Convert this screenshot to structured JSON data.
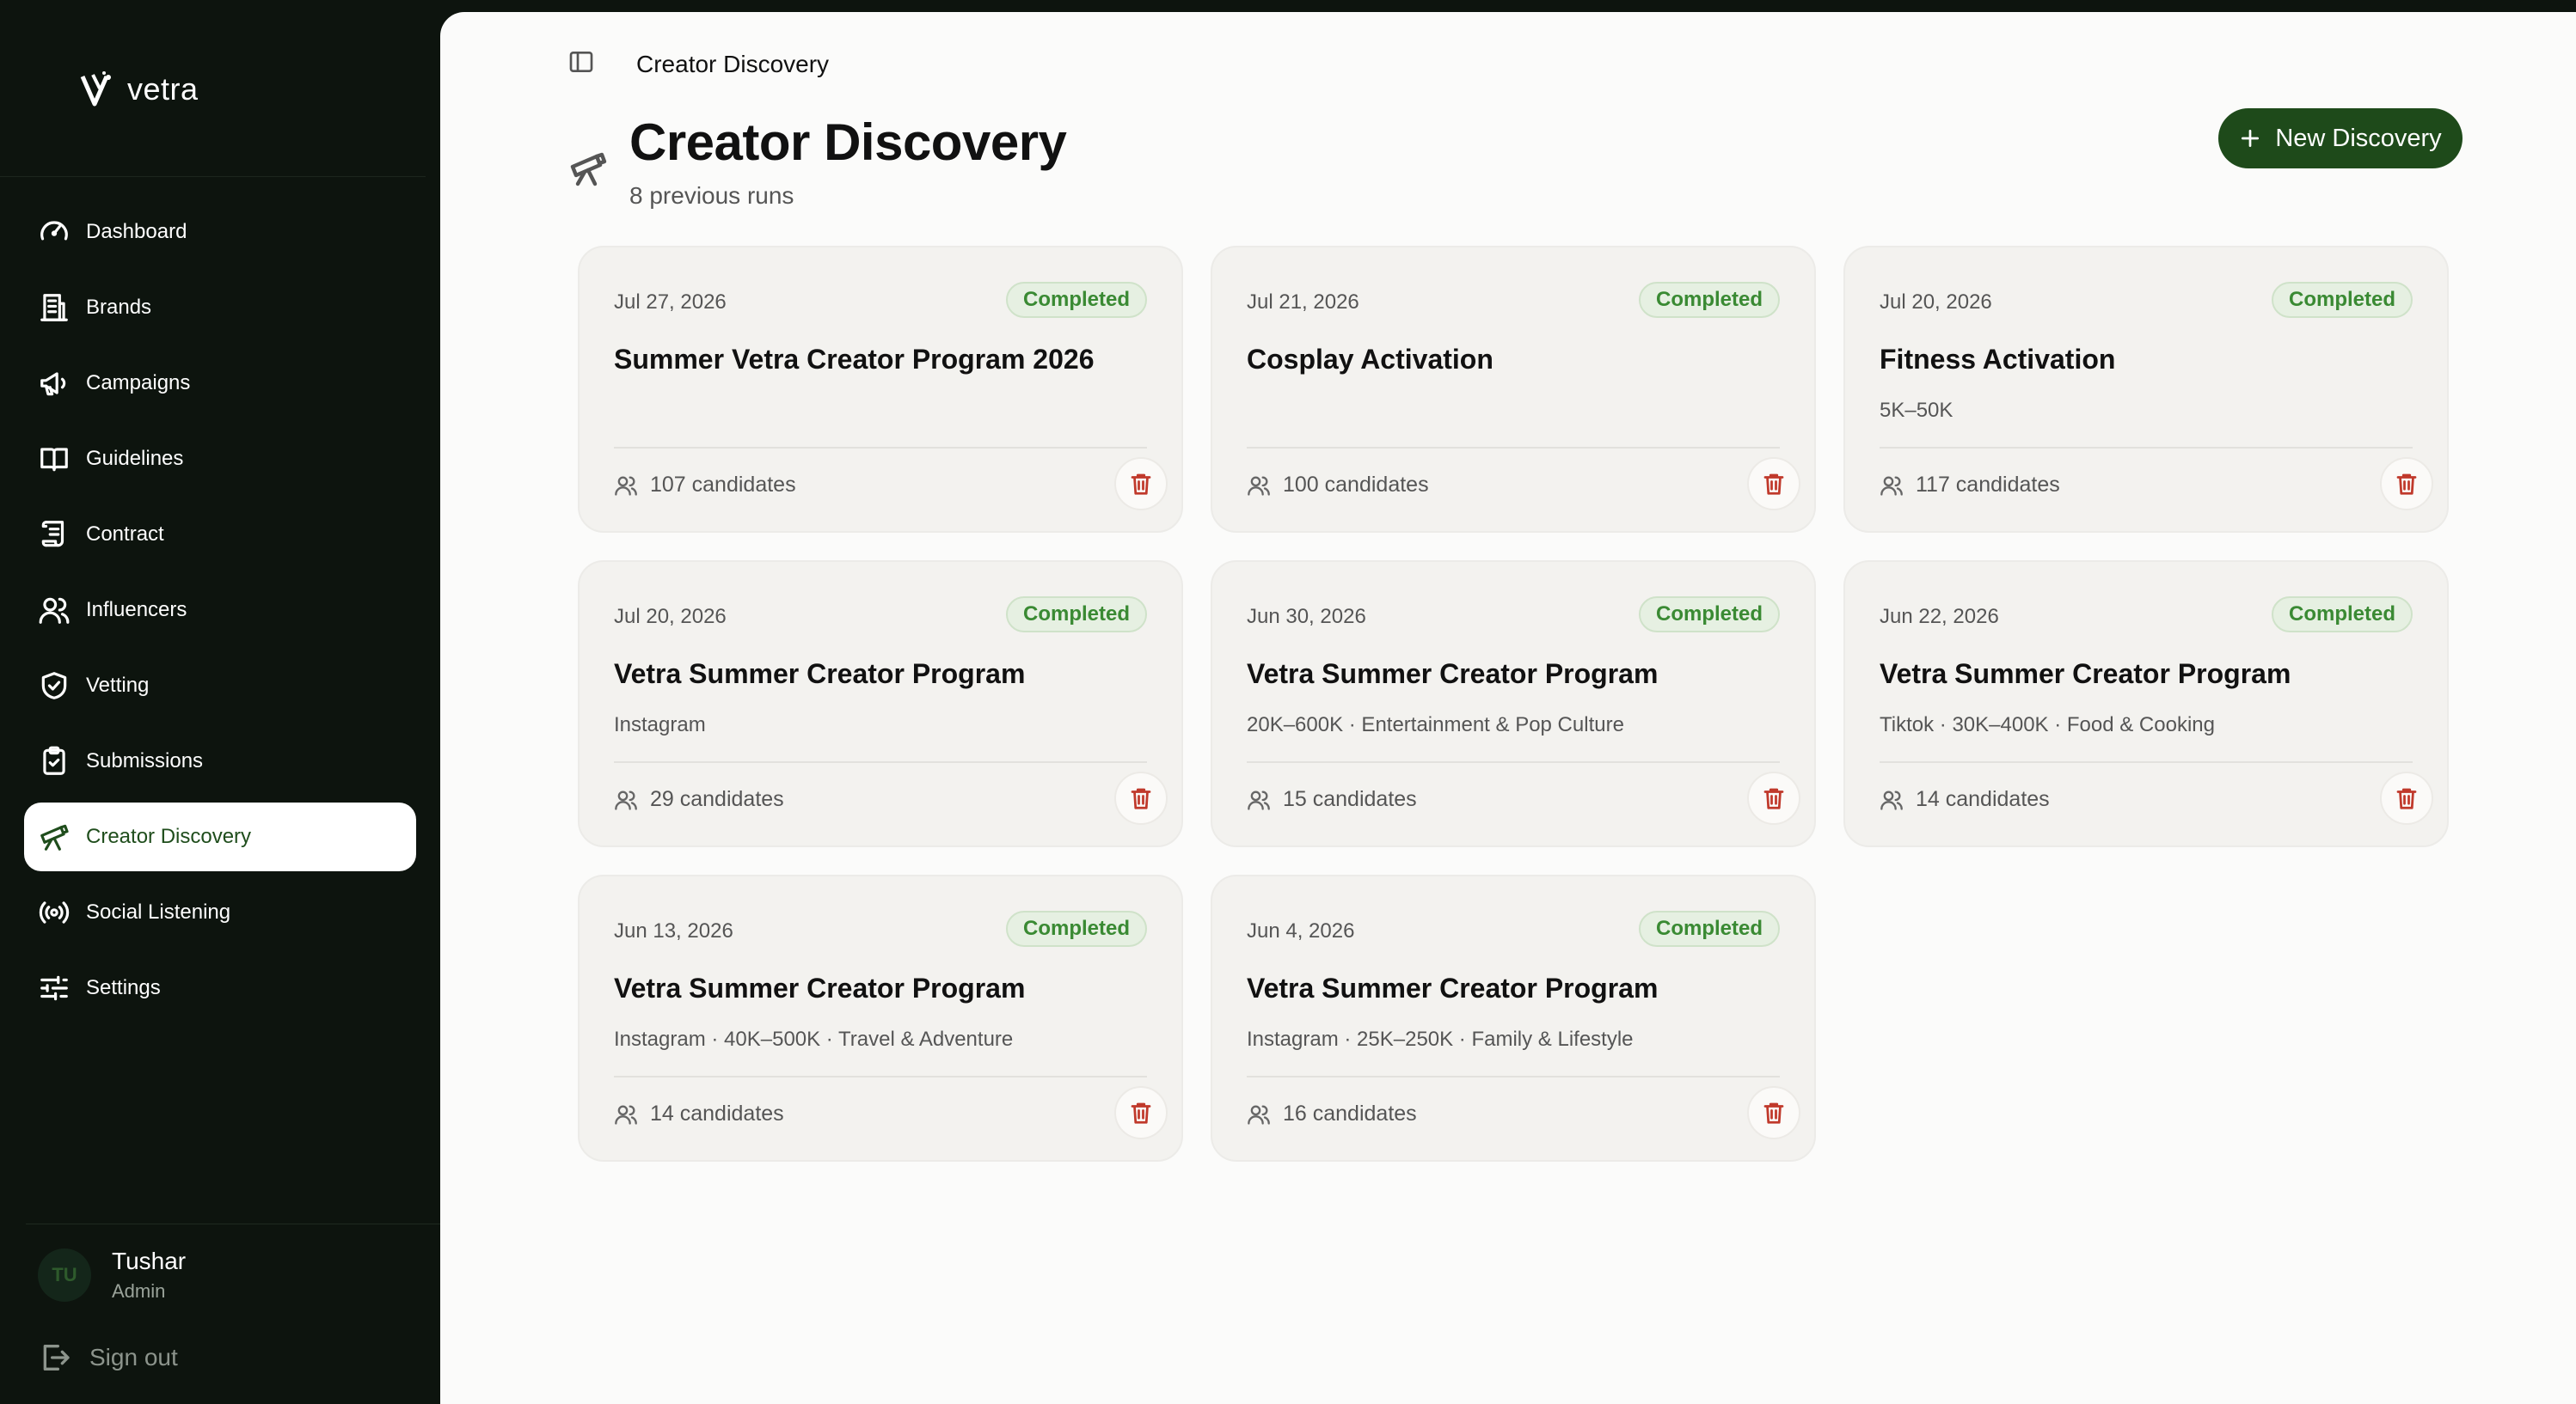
{
  "app": {
    "name": "vetra"
  },
  "sidebar": {
    "items": [
      {
        "label": "Dashboard",
        "icon": "gauge-icon"
      },
      {
        "label": "Brands",
        "icon": "building-icon"
      },
      {
        "label": "Campaigns",
        "icon": "megaphone-icon"
      },
      {
        "label": "Guidelines",
        "icon": "book-icon"
      },
      {
        "label": "Contract",
        "icon": "scroll-icon"
      },
      {
        "label": "Influencers",
        "icon": "users-icon"
      },
      {
        "label": "Vetting",
        "icon": "shield-check-icon"
      },
      {
        "label": "Submissions",
        "icon": "clipboard-check-icon"
      },
      {
        "label": "Creator Discovery",
        "icon": "telescope-icon",
        "active": true
      },
      {
        "label": "Social Listening",
        "icon": "broadcast-icon"
      },
      {
        "label": "Settings",
        "icon": "sliders-icon"
      }
    ],
    "user": {
      "initials": "TU",
      "name": "Tushar",
      "role": "Admin"
    },
    "sign_out": "Sign out"
  },
  "topbar": {
    "breadcrumb": "Creator Discovery"
  },
  "header": {
    "title": "Creator Discovery",
    "subtitle": "8 previous runs",
    "new_button": "New Discovery"
  },
  "cards": [
    {
      "date": "Jul 27, 2026",
      "status": "Completed",
      "title": "Summer Vetra Creator Program 2026",
      "meta": "",
      "candidates": "107 candidates"
    },
    {
      "date": "Jul 21, 2026",
      "status": "Completed",
      "title": "Cosplay Activation",
      "meta": "",
      "candidates": "100 candidates"
    },
    {
      "date": "Jul 20, 2026",
      "status": "Completed",
      "title": "Fitness Activation",
      "meta": "5K–50K",
      "candidates": "117 candidates"
    },
    {
      "date": "Jul 20, 2026",
      "status": "Completed",
      "title": "Vetra Summer Creator Program",
      "meta": "Instagram",
      "candidates": "29 candidates"
    },
    {
      "date": "Jun 30, 2026",
      "status": "Completed",
      "title": "Vetra Summer Creator Program",
      "meta": "20K–600K · Entertainment & Pop Culture",
      "candidates": "15 candidates"
    },
    {
      "date": "Jun 22, 2026",
      "status": "Completed",
      "title": "Vetra Summer Creator Program",
      "meta": "Tiktok · 30K–400K · Food & Cooking",
      "candidates": "14 candidates"
    },
    {
      "date": "Jun 13, 2026",
      "status": "Completed",
      "title": "Vetra Summer Creator Program",
      "meta": "Instagram · 40K–500K · Travel & Adventure",
      "candidates": "14 candidates"
    },
    {
      "date": "Jun 4, 2026",
      "status": "Completed",
      "title": "Vetra Summer Creator Program",
      "meta": "Instagram · 25K–250K · Family & Lifestyle",
      "candidates": "16 candidates"
    }
  ],
  "colors": {
    "sidebar_bg": "#0d140e",
    "accent": "#1e4a1a",
    "status_green": "#3a8a33",
    "delete_red": "#c0392b"
  }
}
